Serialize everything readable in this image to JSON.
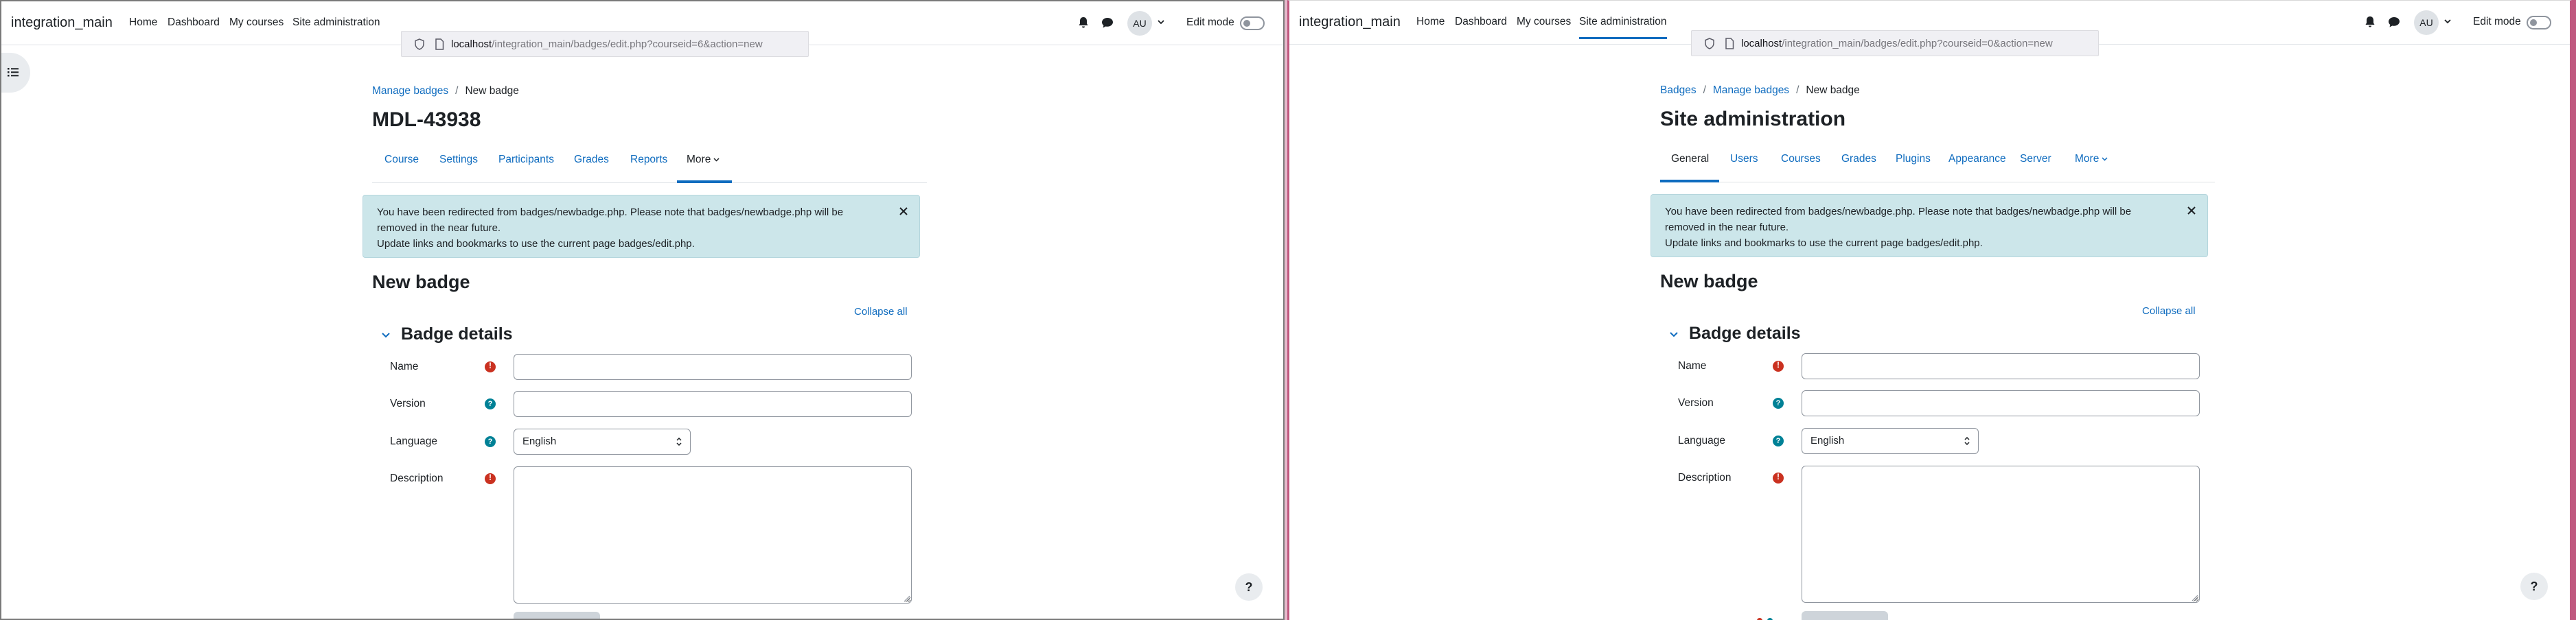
{
  "left": {
    "brand": "integration_main",
    "nav": {
      "home": "Home",
      "dashboard": "Dashboard",
      "my_courses": "My courses",
      "site_admin": "Site administration"
    },
    "user_initials": "AU",
    "edit_mode_label": "Edit mode",
    "url": {
      "host": "localhost",
      "path": "/integration_main/badges/edit.php?courseid=6&action=new"
    },
    "breadcrumb": {
      "item1": "Manage badges",
      "current": "New badge"
    },
    "page_title": "MDL-43938",
    "secondary_nav": {
      "i0": "Course",
      "i1": "Settings",
      "i2": "Participants",
      "i3": "Grades",
      "i4": "Reports",
      "more": "More"
    },
    "alert": {
      "line1": "You have been redirected from badges/newbadge.php. Please note that badges/newbadge.php will be",
      "line2": "removed in the near future.",
      "line3": "Update links and bookmarks to use the current page badges/edit.php."
    },
    "form_title": "New badge",
    "collapse_all": "Collapse all",
    "section_title": "Badge details",
    "fields": {
      "name": "Name",
      "version": "Version",
      "language": "Language",
      "language_value": "English",
      "description": "Description"
    },
    "help_fab": "?"
  },
  "right": {
    "brand": "integration_main",
    "nav": {
      "home": "Home",
      "dashboard": "Dashboard",
      "my_courses": "My courses",
      "site_admin": "Site administration"
    },
    "user_initials": "AU",
    "edit_mode_label": "Edit mode",
    "url": {
      "host": "localhost",
      "path": "/integration_main/badges/edit.php?courseid=0&action=new"
    },
    "breadcrumb": {
      "item0": "Badges",
      "item1": "Manage badges",
      "current": "New badge"
    },
    "page_title": "Site administration",
    "secondary_nav": {
      "i0": "General",
      "i1": "Users",
      "i2": "Courses",
      "i3": "Grades",
      "i4": "Plugins",
      "i5": "Appearance",
      "i6": "Server",
      "more": "More"
    },
    "alert": {
      "line1": "You have been redirected from badges/newbadge.php. Please note that badges/newbadge.php will be",
      "line2": "removed in the near future.",
      "line3": "Update links and bookmarks to use the current page badges/edit.php."
    },
    "form_title": "New badge",
    "collapse_all": "Collapse all",
    "section_title": "Badge details",
    "fields": {
      "name": "Name",
      "version": "Version",
      "language": "Language",
      "language_value": "English",
      "description": "Description"
    },
    "help_fab": "?"
  },
  "colors": {
    "brand_blue": "#0f6cbf",
    "alert_bg": "#cce6ea",
    "required_red": "#ca3120",
    "help_teal": "#008196",
    "window_border": "#c0587f"
  },
  "icons": [
    "bell-icon",
    "chat-icon",
    "chevron-down-icon",
    "shield-icon",
    "page-icon",
    "list-icon",
    "close-icon",
    "required-icon",
    "help-icon",
    "question-icon"
  ]
}
